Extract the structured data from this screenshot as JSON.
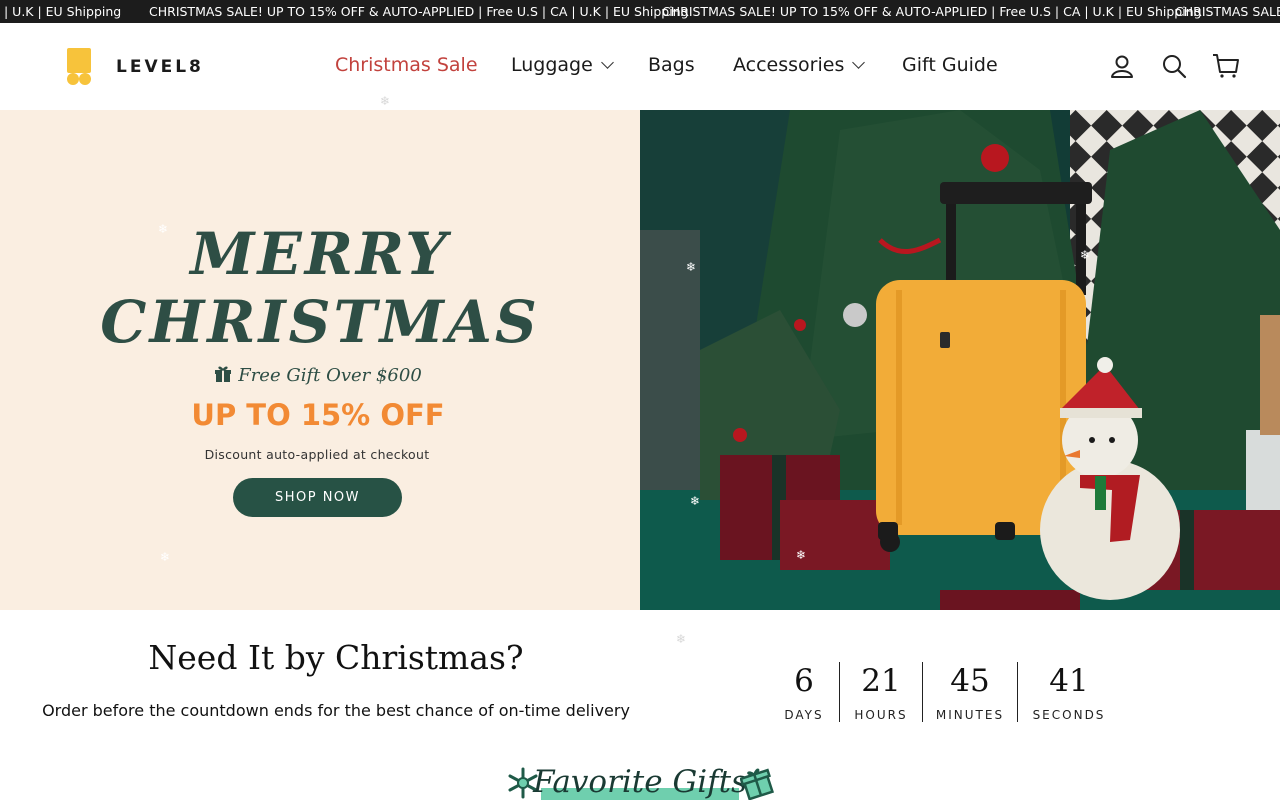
{
  "announcement": {
    "message": "CHRISTMAS SALE! UP TO 15% OFF & AUTO-APPLIED | Free U.S | CA | U.K | EU Shipping",
    "leading_fragment": "| U.K | EU Shipping",
    "trailing_fragment": "CHRISTMAS SALE!"
  },
  "header": {
    "logo_text": "LEVEL8",
    "nav": [
      {
        "label": "Christmas Sale",
        "has_dropdown": false,
        "highlight": true
      },
      {
        "label": "Luggage",
        "has_dropdown": true,
        "highlight": false
      },
      {
        "label": "Bags",
        "has_dropdown": false,
        "highlight": false
      },
      {
        "label": "Accessories",
        "has_dropdown": true,
        "highlight": false
      },
      {
        "label": "Gift Guide",
        "has_dropdown": false,
        "highlight": false
      }
    ],
    "icons": [
      "account-icon",
      "search-icon",
      "cart-icon"
    ]
  },
  "hero": {
    "title_line1": "MERRY",
    "title_line2": "CHRISTMAS",
    "gift_line": "Free Gift Over $600",
    "offer": "UP TO 15% OFF",
    "discount_note": "Discount auto-applied at checkout",
    "cta": "SHOP NOW"
  },
  "countdown_section": {
    "title": "Need It by Christmas?",
    "subtitle": "Order before the countdown ends for the best chance of on-time delivery",
    "units": [
      {
        "value": "6",
        "label": "DAYS"
      },
      {
        "value": "21",
        "label": "HOURS"
      },
      {
        "value": "45",
        "label": "MINUTES"
      },
      {
        "value": "41",
        "label": "SECONDS"
      }
    ]
  },
  "favorites": {
    "title": "Favorite Gifts"
  },
  "colors": {
    "announcement_bg": "#1c1c1c",
    "sale_link": "#c2423d",
    "hero_left_bg": "#faeee1",
    "hero_title": "#2e4e45",
    "offer": "#f28a34",
    "cta_bg": "#275245",
    "logo_yellow": "#f7c33b",
    "highlight": "#6fcfae"
  }
}
